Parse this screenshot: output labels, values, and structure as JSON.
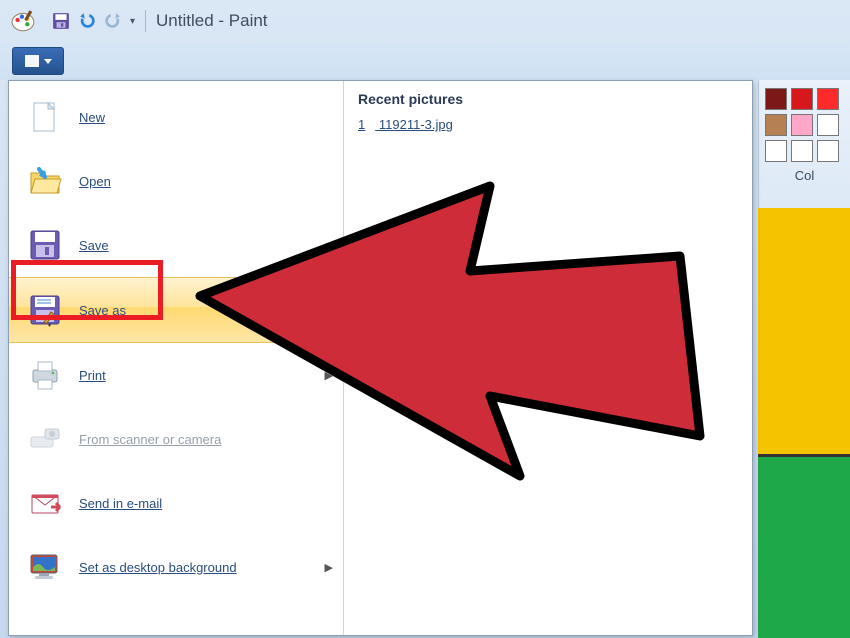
{
  "window": {
    "title": "Untitled - Paint"
  },
  "menu": {
    "items": [
      {
        "label": "New"
      },
      {
        "label": "Open"
      },
      {
        "label": "Save"
      },
      {
        "label": "Save as"
      },
      {
        "label": "Print"
      },
      {
        "label": "From scanner or camera"
      },
      {
        "label": "Send in e-mail"
      },
      {
        "label": "Set as desktop background"
      }
    ]
  },
  "recent": {
    "heading": "Recent pictures",
    "items": [
      {
        "index": "1",
        "name": "119211-3.jpg"
      }
    ]
  },
  "colors": {
    "label": "Col",
    "row1": [
      "#7a1917",
      "#d8171d",
      "#ff2a2a"
    ],
    "row2": [
      "#b58154",
      "#ffa6c9",
      "#ffffff"
    ]
  }
}
